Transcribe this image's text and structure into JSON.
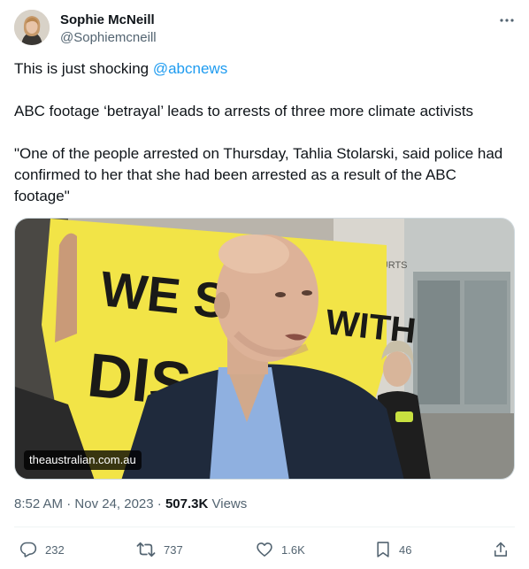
{
  "author": {
    "display_name": "Sophie McNeill",
    "handle": "@Sophiemcneill"
  },
  "tweet": {
    "line1_text": "This is just shocking ",
    "line1_mention": "@abcnews",
    "line2_text": "ABC footage ‘betrayal’ leads to arrests of three more climate activists",
    "line3_text": "\"One of the people arrested on Thursday, Tahlia Stolarski, said police had confirmed to her that she had been arrested as a result of the ABC footage\""
  },
  "media": {
    "source_label": "theaustralian.com.au",
    "banner_text": "WE ST   WITH DIS",
    "building_sign": "L LAW COURTS"
  },
  "meta": {
    "time": "8:52 AM",
    "separator": " · ",
    "date": "Nov 24, 2023",
    "views_count": "507.3K",
    "views_label": " Views"
  },
  "actions": {
    "replies": "232",
    "reposts": "737",
    "likes": "1.6K",
    "bookmarks": "46"
  },
  "colors": {
    "link": "#1d9bf0",
    "secondary_text": "#536471",
    "primary_text": "#0f1419",
    "banner_yellow": "#f2e447"
  }
}
